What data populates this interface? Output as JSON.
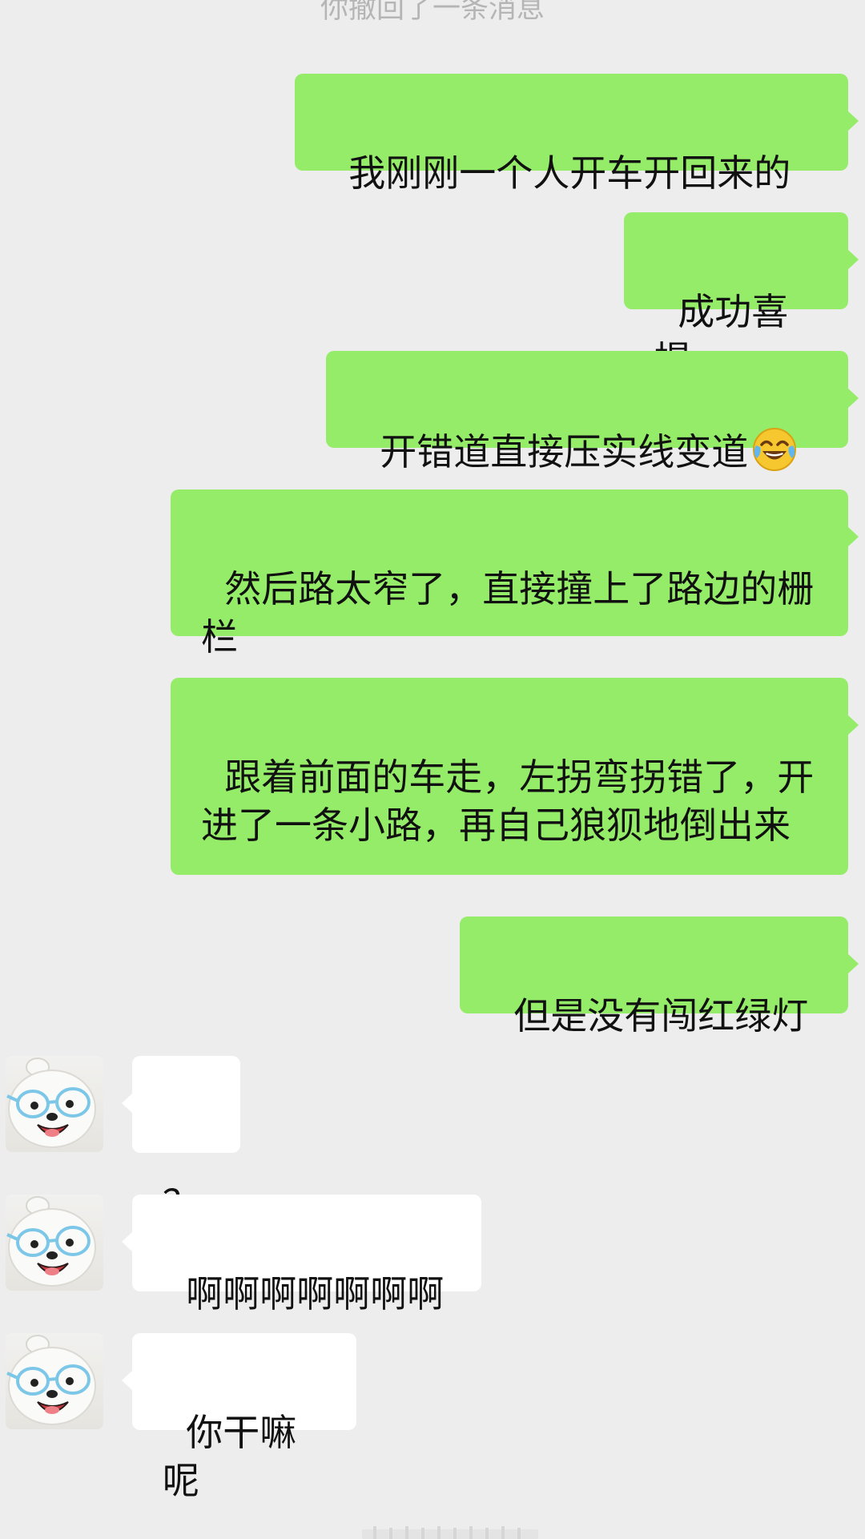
{
  "system_notice": "你撤回了一条消息",
  "messages": [
    {
      "sender": "me",
      "text": "我刚刚一个人开车开回来的"
    },
    {
      "sender": "me",
      "text": "成功喜提"
    },
    {
      "sender": "me",
      "text": "开错道直接压实线变道",
      "emoji": "face-with-tears-of-joy"
    },
    {
      "sender": "me",
      "text": "然后路太窄了，直接撞上了路边的栅栏"
    },
    {
      "sender": "me",
      "text": "跟着前面的车走，左拐弯拐错了，开进了一条小路，再自己狼狈地倒出来"
    },
    {
      "sender": "me",
      "text": "但是没有闯红绿灯"
    },
    {
      "sender": "other",
      "text": "？"
    },
    {
      "sender": "other",
      "text": "啊啊啊啊啊啊啊"
    },
    {
      "sender": "other",
      "text": "你干嘛呢"
    }
  ],
  "colors": {
    "background": "#ededed",
    "sent_bubble": "#95ec69",
    "received_bubble": "#ffffff",
    "system_text": "#b5b5b5"
  }
}
